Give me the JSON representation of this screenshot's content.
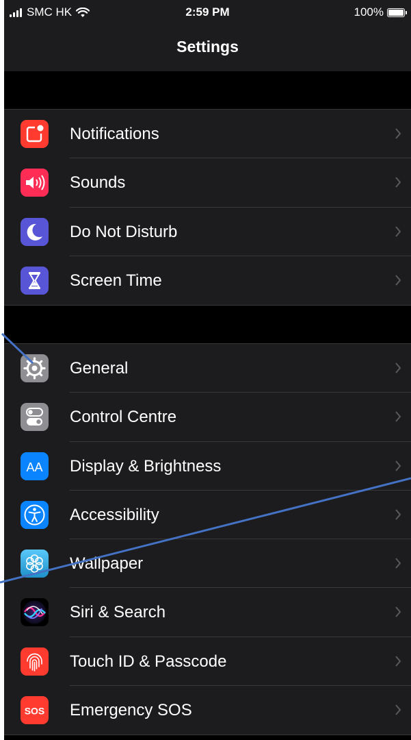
{
  "status_bar": {
    "carrier": "SMC HK",
    "time": "2:59 PM",
    "battery_text": "100%",
    "icons": [
      "signal-bars-icon",
      "wifi-icon",
      "battery-icon"
    ]
  },
  "nav": {
    "title": "Settings"
  },
  "groups": [
    {
      "items": [
        {
          "label": "Notifications",
          "icon": "notifications-icon",
          "color": "#ff3b30"
        },
        {
          "label": "Sounds",
          "icon": "sounds-icon",
          "color": "#ff2d55"
        },
        {
          "label": "Do Not Disturb",
          "icon": "moon-icon",
          "color": "#5856d6"
        },
        {
          "label": "Screen Time",
          "icon": "hourglass-icon",
          "color": "#5856d6"
        }
      ]
    },
    {
      "items": [
        {
          "label": "General",
          "icon": "gear-icon",
          "color": "#8e8e93"
        },
        {
          "label": "Control Centre",
          "icon": "toggles-icon",
          "color": "#8e8e93"
        },
        {
          "label": "Display & Brightness",
          "icon": "text-size-icon",
          "color": "#0a84ff",
          "icon_text": "AA"
        },
        {
          "label": "Accessibility",
          "icon": "accessibility-icon",
          "color": "#0a84ff"
        },
        {
          "label": "Wallpaper",
          "icon": "flower-icon",
          "color": "#32ade6"
        },
        {
          "label": "Siri & Search",
          "icon": "siri-icon",
          "color": "#1c1c1e"
        },
        {
          "label": "Touch ID & Passcode",
          "icon": "fingerprint-icon",
          "color": "#ff3b30"
        },
        {
          "label": "Emergency SOS",
          "icon": "sos-icon",
          "color": "#ff3b30",
          "icon_text": "SOS"
        }
      ]
    }
  ],
  "annotation": {
    "color": "#4472c4"
  }
}
